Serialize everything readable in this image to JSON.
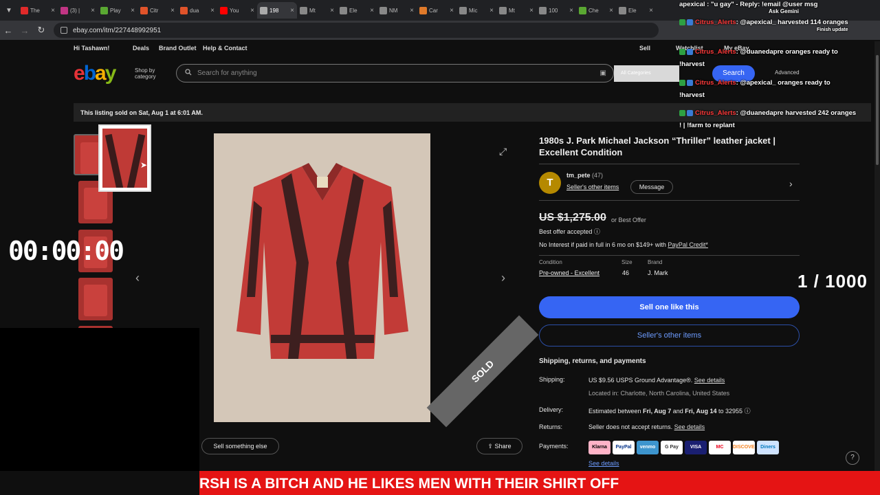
{
  "tabs": [
    {
      "label": "The",
      "color": "#e02a2a"
    },
    {
      "label": "(3) |",
      "color": "#c13584"
    },
    {
      "label": "Play",
      "color": "#5aa832"
    },
    {
      "label": "Citr",
      "color": "#e0532a"
    },
    {
      "label": "dua",
      "color": "#e0532a"
    },
    {
      "label": "You",
      "color": "#ff0000"
    },
    {
      "label": "198",
      "color": "#aaaaaa"
    },
    {
      "label": "Mt",
      "color": "#888888"
    },
    {
      "label": "Ele",
      "color": "#888888"
    },
    {
      "label": "NM",
      "color": "#888888"
    },
    {
      "label": "Car",
      "color": "#e07a2a"
    },
    {
      "label": "Mic",
      "color": "#888888"
    },
    {
      "label": "Mt",
      "color": "#888888"
    },
    {
      "label": "100",
      "color": "#888888"
    },
    {
      "label": "Che",
      "color": "#5aa832"
    },
    {
      "label": "Ele",
      "color": "#888888"
    }
  ],
  "address": {
    "url": "ebay.com/itm/227448992951"
  },
  "topnav": {
    "greeting": "Hi Tashawn!",
    "deals": "Deals",
    "brand_outlet": "Brand Outlet",
    "help": "Help & Contact",
    "sell": "Sell",
    "watchlist": "Watchlist",
    "myebay": "My eBay"
  },
  "header": {
    "logo": "ebay",
    "shop_by": "Shop by",
    "category": "category",
    "search_placeholder": "Search for anything",
    "category_select": "All Categories",
    "search_button": "Search",
    "advanced": "Advanced"
  },
  "banner": "This listing sold on Sat, Aug 1 at 6:01 AM.",
  "overlay": {
    "clock": "00:00:00",
    "counter": "1 / 1000"
  },
  "listing": {
    "title": "1980s J. Park Michael Jackson “Thriller” leather jacket | Excellent Condition",
    "seller_initial": "T",
    "seller_name": "tm_pete",
    "seller_score": "(47)",
    "seller_other": "Seller's other items",
    "message": "Message",
    "price": "US $1,275.00",
    "or_best_offer": "or Best Offer",
    "best_offer_accepted": "Best offer accepted",
    "no_interest": "No Interest if paid in full in 6 mo on $149+ with",
    "paypal_credit": "PayPal Credit*",
    "condition_label": "Condition",
    "condition_value": "Pre-owned - Excellent",
    "size_label": "Size",
    "size_value": "46",
    "brand_label": "Brand",
    "brand_value": "J. Mark",
    "sell_one": "Sell one like this",
    "seller_items_btn": "Seller's other items",
    "sold_label": "SOLD",
    "sell_something": "Sell something else",
    "share": "Share"
  },
  "shipping": {
    "heading": "Shipping, returns, and payments",
    "shipping_label": "Shipping:",
    "shipping_value": "US $9.56 USPS Ground Advantage®.",
    "see_details": "See details",
    "location": "Located in: Charlotte, North Carolina, United States",
    "delivery_label": "Delivery:",
    "delivery_pre": "Estimated between",
    "delivery_from": "Fri, Aug 7",
    "delivery_and": "and",
    "delivery_to": "Fri, Aug 14",
    "delivery_zip": "to 32955",
    "returns_label": "Returns:",
    "returns_value": "Seller does not accept returns.",
    "payments_label": "Payments:",
    "payment_methods": [
      "Klarna",
      "PayPal",
      "venmo",
      "G Pay",
      "VISA",
      "MC",
      "DISCOVER",
      "Diners"
    ]
  },
  "chat": {
    "line1": "apexical : \"u gay\" - Reply: !email @user msg",
    "line2_user": "Citrus_Alerts",
    "line2_msg": ": @apexical_ harvested 114 oranges",
    "line3_user": "Citrus_Alerts",
    "line3_msg": ": @duanedapre oranges ready to",
    "line3b": "!harvest",
    "line4_user": "Citrus_Alerts",
    "line4_msg": ": @apexical_ oranges ready to",
    "line4b": "!harvest",
    "line5_user": "Citrus_Alerts",
    "line5_msg": ": @duanedapre harvested 242 oranges",
    "line5b": "! | !farm to replant",
    "ask_gemini": "Ask Gemini",
    "finish_update": "Finish update"
  },
  "ticker": "RSH IS A BITCH AND HE LIKES MEN WITH THEIR SHIRT OFF",
  "colors": {
    "accent": "#3665f3",
    "ticker_bg": "#e51414",
    "sold_ribbon": "#666666",
    "jacket_red": "#c23b37"
  }
}
